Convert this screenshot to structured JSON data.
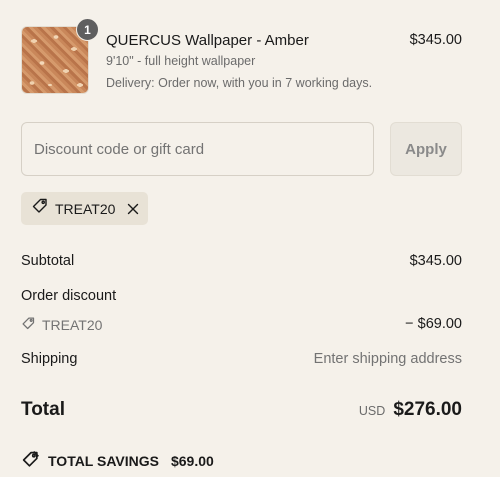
{
  "line_item": {
    "quantity": "1",
    "title": "QUERCUS Wallpaper - Amber",
    "variant": "9'10\" - full height wallpaper",
    "delivery": "Delivery: Order now, with you in 7 working days.",
    "price": "$345.00"
  },
  "discount_form": {
    "placeholder": "Discount code or gift card",
    "value": "",
    "apply_label": "Apply"
  },
  "applied_code": {
    "code": "TREAT20",
    "icon": "tag-icon",
    "remove_icon": "close-icon"
  },
  "summary": {
    "subtotal_label": "Subtotal",
    "subtotal_value": "$345.00",
    "order_discount_label": "Order discount",
    "order_discount_code": "TREAT20",
    "order_discount_value": "− $69.00",
    "shipping_label": "Shipping",
    "shipping_value": "Enter shipping address",
    "total_label": "Total",
    "currency": "USD",
    "total_value": "$276.00",
    "savings_label": "TOTAL SAVINGS",
    "savings_value": "$69.00"
  }
}
